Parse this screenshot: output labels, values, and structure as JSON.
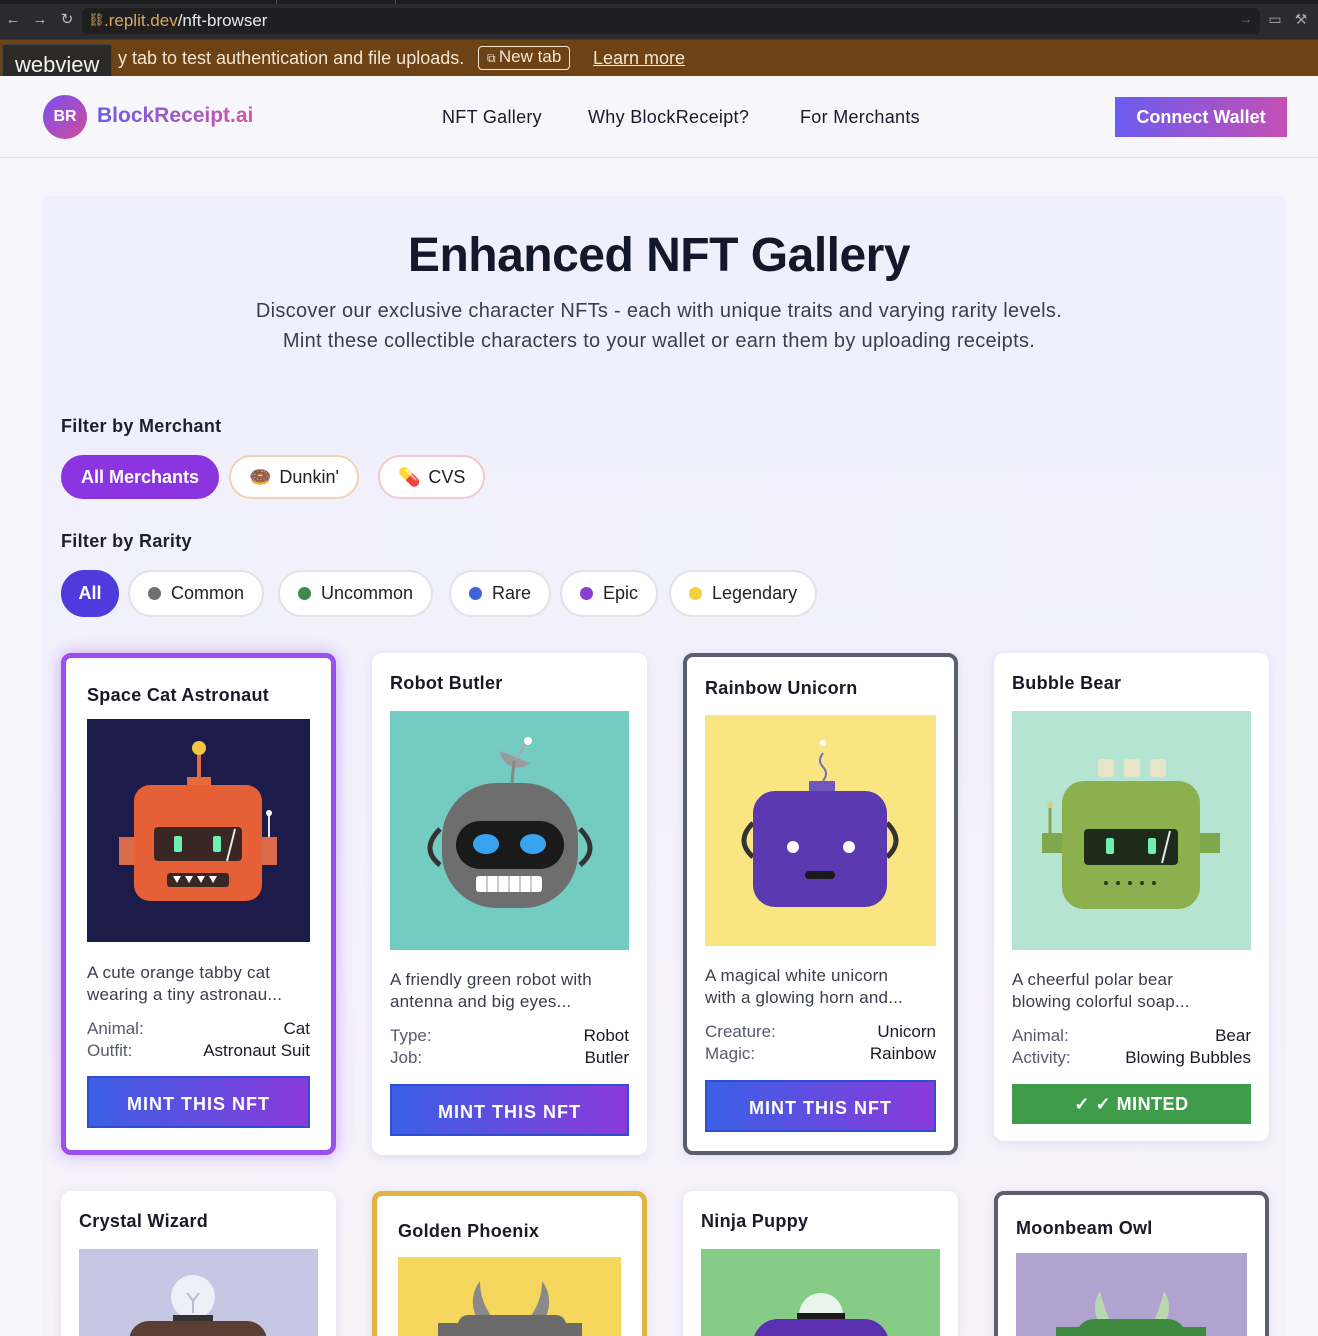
{
  "browser": {
    "url_domain": ".replit.dev",
    "url_path": "/nft-browser"
  },
  "banner": {
    "text": "y tab to test authentication and file uploads.",
    "new_tab": "New tab",
    "learn_more": "Learn more",
    "webview_label": "webview"
  },
  "header": {
    "logo_initials": "BR",
    "logo_text": "BlockReceipt.ai",
    "nav": [
      "NFT Gallery",
      "Why BlockReceipt?",
      "For Merchants"
    ],
    "connect": "Connect Wallet"
  },
  "hero": {
    "title": "Enhanced NFT Gallery",
    "subtitle_1": "Discover our exclusive character NFTs - each with unique traits and varying rarity levels.",
    "subtitle_2": "Mint these collectible characters to your wallet or earn them by uploading receipts."
  },
  "filters": {
    "merchant_label": "Filter by Merchant",
    "merchants": [
      "All Merchants",
      "Dunkin'",
      "CVS"
    ],
    "merchant_emojis": [
      "",
      "🍩",
      "💊"
    ],
    "rarity_label": "Filter by Rarity",
    "rarities": [
      "All",
      "Common",
      "Uncommon",
      "Rare",
      "Epic",
      "Legendary"
    ],
    "rarity_colors": [
      "",
      "#6f6f6f",
      "#3f8a4c",
      "#3f63d8",
      "#8a3fd1",
      "#f2d23c"
    ]
  },
  "cards": [
    {
      "title": "Space Cat Astronaut",
      "desc_1": "A cute orange tabby cat",
      "desc_2": "wearing a tiny astronau...",
      "k1": "Animal:",
      "v1": "Cat",
      "k2": "Outfit:",
      "v2": "Astronaut Suit",
      "action": "MINT THIS NFT"
    },
    {
      "title": "Robot Butler",
      "desc_1": "A friendly green robot with",
      "desc_2": "antenna and big eyes...",
      "k1": "Type:",
      "v1": "Robot",
      "k2": "Job:",
      "v2": "Butler",
      "action": "MINT THIS NFT"
    },
    {
      "title": "Rainbow Unicorn",
      "desc_1": "A magical white unicorn",
      "desc_2": "with a glowing horn and...",
      "k1": "Creature:",
      "v1": "Unicorn",
      "k2": "Magic:",
      "v2": "Rainbow",
      "action": "MINT THIS NFT"
    },
    {
      "title": "Bubble Bear",
      "desc_1": "A cheerful polar bear",
      "desc_2": "blowing colorful soap...",
      "k1": "Animal:",
      "v1": "Bear",
      "k2": "Activity:",
      "v2": "Blowing Bubbles",
      "action": "✓ ✓ MINTED"
    },
    {
      "title": "Crystal Wizard"
    },
    {
      "title": "Golden Phoenix"
    },
    {
      "title": "Ninja Puppy"
    },
    {
      "title": "Moonbeam Owl"
    }
  ],
  "colors": {
    "accent_purple": "#8a35e0",
    "rarity_active": "#4d3bdc",
    "minted_green": "#3f9c4a"
  }
}
